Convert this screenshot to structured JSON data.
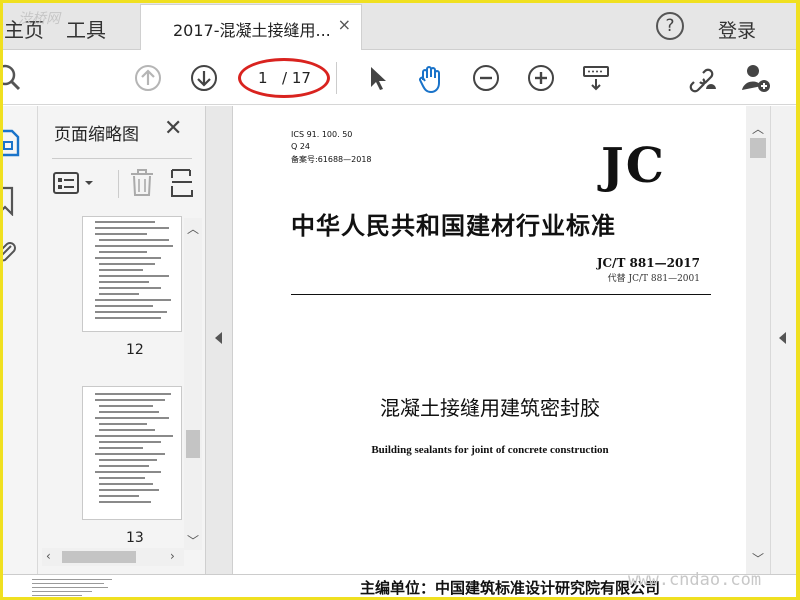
{
  "tabs": {
    "home": "主页",
    "tools": "工具",
    "document_title": "2017-混凝土接缝用...",
    "close_symbol": "×"
  },
  "watermark_top": "渋桥网",
  "header": {
    "help_symbol": "?",
    "login": "登录"
  },
  "toolbar": {
    "current_page": "1",
    "total_pages": "/ 17"
  },
  "thumbnail_panel": {
    "title": "页面缩略图",
    "close_symbol": "✕",
    "thumbnails": [
      {
        "label": "12"
      },
      {
        "label": "13"
      }
    ]
  },
  "document": {
    "ics": "ICS 91. 100. 50",
    "q": "Q 24",
    "record": "备案号:61688—2018",
    "logo_text": "JC",
    "org": "中华人民共和国建材行业标准",
    "code": "JC/T  881—2017",
    "replaces": "代替 JC/T  881—2001",
    "title_cn": "混凝土接缝用建筑密封胶",
    "title_en": "Building sealants for joint of concrete construction",
    "footer": "主编单位：中国建筑标准设计研究院有限公司"
  },
  "watermark_bottom": "www.cndao.com",
  "colors": {
    "accent_blue": "#1a73c9",
    "annotation_red": "#d9231f",
    "frame_yellow": "#f0e020"
  }
}
